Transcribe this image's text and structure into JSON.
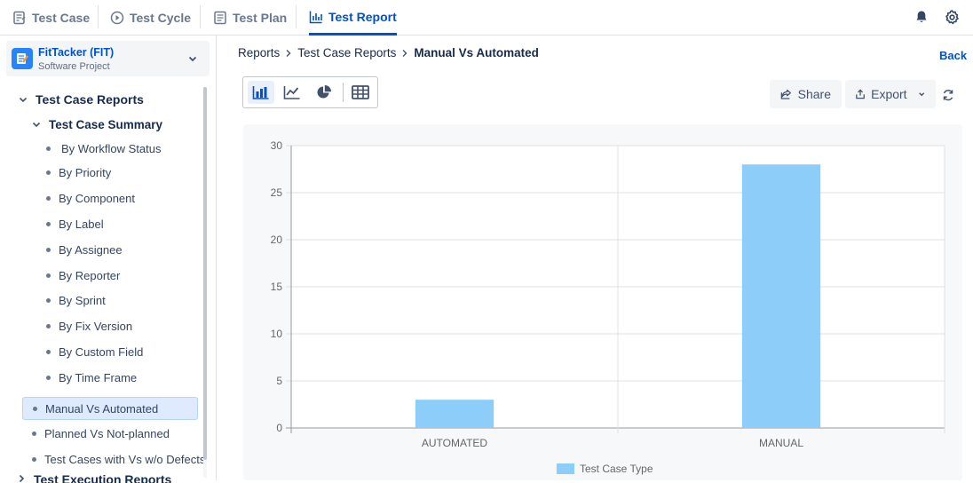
{
  "tabs": [
    {
      "label": "Test Case",
      "icon": "test-case-icon"
    },
    {
      "label": "Test Cycle",
      "icon": "test-cycle-icon"
    },
    {
      "label": "Test Plan",
      "icon": "test-plan-icon"
    },
    {
      "label": "Test Report",
      "icon": "bar-chart-icon",
      "active": true
    }
  ],
  "header_icons": [
    "bell-icon",
    "gear-icon"
  ],
  "project": {
    "name": "FitTacker (FIT)",
    "type": "Software Project"
  },
  "sidebar": {
    "group": "Test Case Reports",
    "subgroup": "Test Case Summary",
    "summary_items": [
      "By Workflow Status",
      "By Priority",
      "By Component",
      "By Label",
      "By Assignee",
      "By Reporter",
      "By Sprint",
      "By Fix Version",
      "By Custom Field",
      "By Time Frame"
    ],
    "reports": [
      "Manual Vs Automated",
      "Planned Vs Not-planned",
      "Test Cases with Vs w/o Defects"
    ],
    "selected_report": "Manual Vs Automated",
    "next_group": "Test Execution Reports"
  },
  "breadcrumb": {
    "root": "Reports",
    "middle": "Test Case Reports",
    "current": "Manual Vs Automated"
  },
  "back_label": "Back",
  "view_modes": [
    "bar-chart-icon",
    "line-chart-icon",
    "pie-chart-icon",
    "table-icon"
  ],
  "actions": {
    "share_label": "Share",
    "export_label": "Export"
  },
  "colors": {
    "accent": "#0052cc",
    "bar": "#8ccdf9",
    "selected_bg": "#deebff"
  },
  "chart_data": {
    "type": "bar",
    "categories": [
      "AUTOMATED",
      "MANUAL"
    ],
    "series": [
      {
        "name": "Test Case Type",
        "values": [
          3,
          28
        ]
      }
    ],
    "ylim": [
      0,
      30
    ],
    "yticks": [
      0,
      5,
      10,
      15,
      20,
      25,
      30
    ],
    "grid": true,
    "legend": "bottom"
  }
}
